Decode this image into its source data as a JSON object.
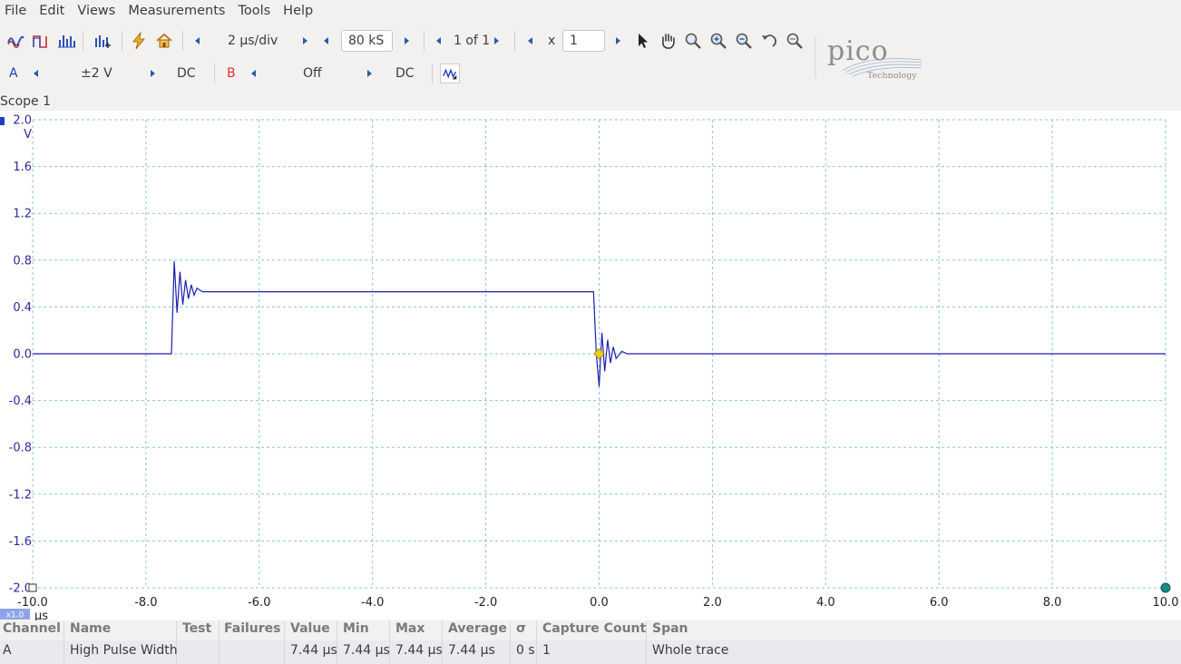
{
  "menu": [
    "File",
    "Edit",
    "Views",
    "Measurements",
    "Tools",
    "Help"
  ],
  "toolbar": {
    "timebase": "2 µs/div",
    "samples": "80 kS",
    "capture": "1 of 1",
    "zoom_x_label": "x",
    "zoom_x_value": "1"
  },
  "channels": {
    "a": {
      "label": "A",
      "range": "±2 V",
      "coupling": "DC",
      "color": "#1f3fbf"
    },
    "b": {
      "label": "B",
      "range": "Off",
      "coupling": "DC",
      "color": "#e03030"
    }
  },
  "logo": {
    "brand": "pico",
    "sub": "Technology"
  },
  "scope": {
    "title": "Scope 1",
    "y_unit": "V",
    "x_unit": "µs",
    "zoom_badge": "x1.0",
    "trigger_color": "#e8d200"
  },
  "chart_data": {
    "type": "line",
    "xlim": [
      -10,
      10
    ],
    "ylim": [
      -2,
      2
    ],
    "x_ticks": [
      "-10.0",
      "-8.0",
      "-6.0",
      "-4.0",
      "-2.0",
      "0.0",
      "2.0",
      "4.0",
      "6.0",
      "8.0",
      "10.0"
    ],
    "y_ticks": [
      "2.0",
      "1.6",
      "1.2",
      "0.8",
      "0.4",
      "0.0",
      "-0.4",
      "-0.8",
      "-1.2",
      "-1.6",
      "-2.0"
    ],
    "grid": true,
    "series": [
      {
        "name": "A",
        "color": "#1f1fb0",
        "x": [
          -10.0,
          -7.55,
          -7.5,
          -7.45,
          -7.4,
          -7.35,
          -7.3,
          -7.25,
          -7.2,
          -7.15,
          -7.1,
          -7.0,
          -6.9,
          -6.5,
          -0.1,
          -0.05,
          0.0,
          0.05,
          0.1,
          0.15,
          0.2,
          0.25,
          0.3,
          0.4,
          0.5,
          0.8,
          10.0
        ],
        "y": [
          0.0,
          0.0,
          0.79,
          0.35,
          0.7,
          0.42,
          0.63,
          0.47,
          0.59,
          0.5,
          0.56,
          0.53,
          0.53,
          0.53,
          0.53,
          0.0,
          -0.28,
          0.18,
          -0.15,
          0.12,
          -0.08,
          0.06,
          -0.04,
          0.02,
          0.0,
          0.0,
          0.0
        ]
      }
    ]
  },
  "measurements": {
    "headers": [
      "Channel",
      "Name",
      "Test",
      "Failures",
      "Value",
      "Min",
      "Max",
      "Average",
      "σ",
      "Capture Count",
      "Span"
    ],
    "rows": [
      [
        "A",
        "High Pulse Width",
        "",
        "",
        "7.44 µs",
        "7.44 µs",
        "7.44 µs",
        "7.44 µs",
        "0 s",
        "1",
        "Whole trace"
      ]
    ]
  }
}
